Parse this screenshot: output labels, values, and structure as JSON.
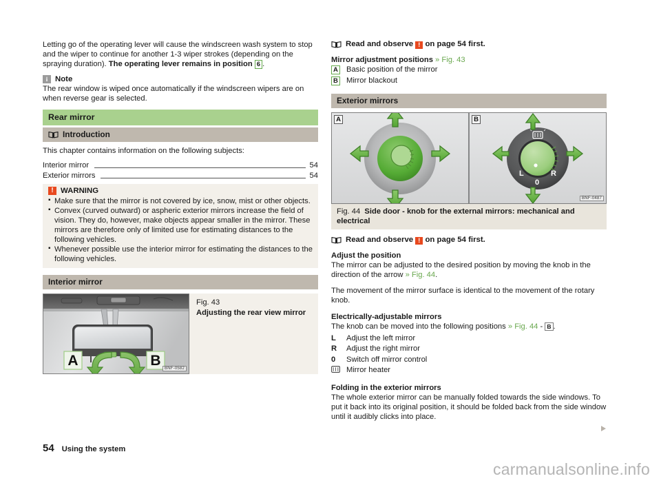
{
  "left": {
    "intro_paragraph": {
      "text_a": "Letting go of the operating lever will cause the windscreen wash system to stop and the wiper to continue for another 1-3 wiper strokes (depending on the spraying duration). ",
      "text_b": "The operating lever remains in position",
      "badge": "6",
      "text_c": "."
    },
    "note": {
      "icon": "info-icon",
      "title": "Note",
      "body": "The rear window is wiped once automatically if the windscreen wipers are on when reverse gear is selected."
    },
    "section_title": "Rear mirror",
    "introduction": {
      "icon": "book-icon",
      "title": "Introduction",
      "lead": "This chapter contains information on the following subjects:",
      "toc": [
        {
          "label": "Interior mirror",
          "page": "54"
        },
        {
          "label": "Exterior mirrors",
          "page": "54"
        }
      ]
    },
    "warning": {
      "icon": "warning-icon",
      "title": "WARNING",
      "items": [
        "Make sure that the mirror is not covered by ice, snow, mist or other objects.",
        "Convex (curved outward) or aspheric exterior mirrors increase the field of vision. They do, however, make objects appear smaller in the mirror. These mirrors are therefore only of limited use for estimating distances to the following vehicles.",
        "Whenever possible use the interior mirror for estimating the distances to the following vehicles."
      ]
    },
    "interior_mirror_bar": "Interior mirror",
    "fig43": {
      "number": "Fig. 43",
      "caption": "Adjusting the rear view mirror",
      "code": "BNF-0582",
      "label_a": "A",
      "label_b": "B"
    }
  },
  "right": {
    "read_observe_1": {
      "icon": "book-icon",
      "prefix": "Read and observe ",
      "warn_icon": "warning-icon",
      "suffix": " on page 54 first."
    },
    "adjustment": {
      "title": "Mirror adjustment positions",
      "ref": "» Fig. 43",
      "rows": [
        {
          "key": "A",
          "label": "Basic position of the mirror"
        },
        {
          "key": "B",
          "label": "Mirror blackout"
        }
      ]
    },
    "exterior_mirrors_bar": "Exterior mirrors",
    "fig44": {
      "number": "Fig. 44",
      "caption": "Side door - knob for the external mirrors: mechanical and electrical",
      "code": "BNF-0487",
      "label_a": "A",
      "label_b": "B",
      "knob_l": "L",
      "knob_0": "0",
      "knob_r": "R"
    },
    "read_observe_2": {
      "icon": "book-icon",
      "prefix": "Read and observe ",
      "warn_icon": "warning-icon",
      "suffix": " on page 54 first."
    },
    "adjust_position": {
      "title": "Adjust the position",
      "body_a": "The mirror can be adjusted to the desired position by moving the knob in the direction of the arrow ",
      "ref": "» Fig. 44",
      "body_b": ".",
      "body2": "The movement of the mirror surface is identical to the movement of the rotary knob."
    },
    "electric": {
      "title": "Electrically-adjustable mirrors",
      "lead_a": "The knob can be moved into the following positions ",
      "ref": "» Fig. 44",
      "lead_sep": " - ",
      "lead_badge": "B",
      "lead_b": ".",
      "rows": [
        {
          "key": "L",
          "label": "Adjust the left mirror"
        },
        {
          "key": "R",
          "label": "Adjust the right mirror"
        },
        {
          "key": "0",
          "label": "Switch off mirror control"
        },
        {
          "key": "☷",
          "label": "Mirror heater"
        }
      ]
    },
    "folding": {
      "title": "Folding in the exterior mirrors",
      "body": "The whole exterior mirror can be manually folded towards the side windows. To put it back into its original position, it should be folded back from the side window until it audibly clicks into place."
    }
  },
  "footer": {
    "page_number": "54",
    "chapter": "Using the system",
    "watermark": "carmanualsonline.info"
  },
  "colors": {
    "section_green": "#a9d18e",
    "bar_grey": "#bfb8ae",
    "warning_orange": "#e8491f",
    "link_green": "#6aa84f",
    "fig_bg": "#f3f0ea"
  }
}
